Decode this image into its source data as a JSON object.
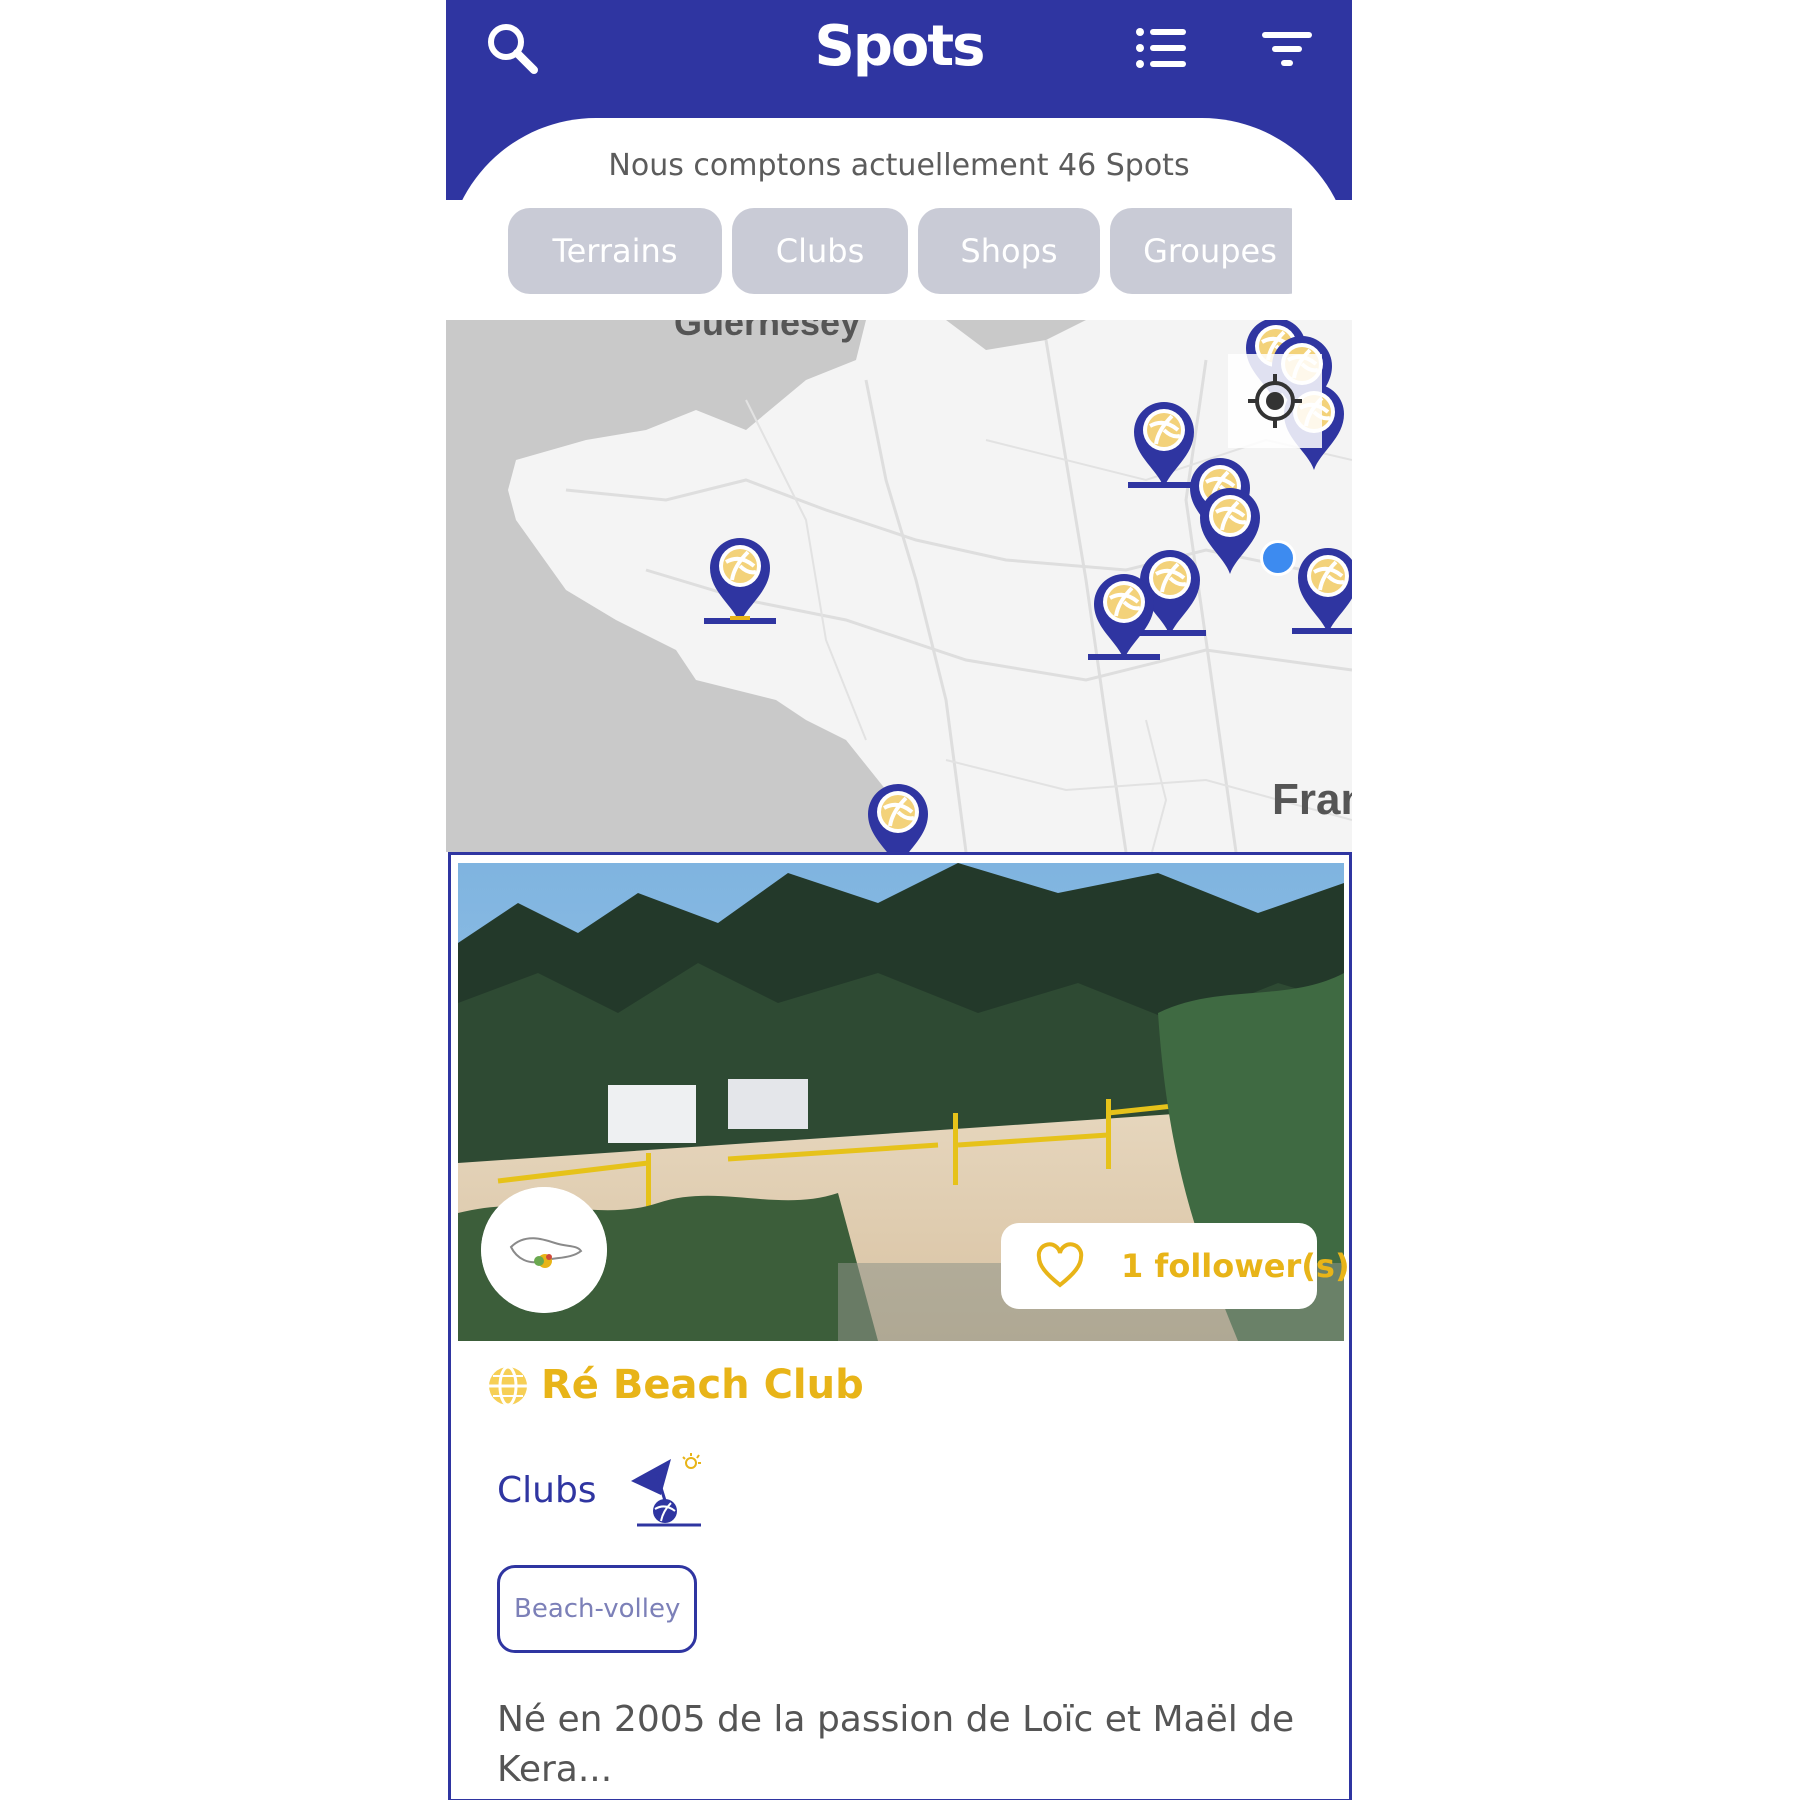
{
  "header": {
    "title": "Spots",
    "left_icon": "search-icon",
    "right_icons": [
      "list-icon",
      "filter-icon"
    ]
  },
  "summary": {
    "text": "Nous comptons actuellement 46 Spots"
  },
  "categories": [
    "Terrains",
    "Clubs",
    "Shops",
    "Groupes"
  ],
  "map": {
    "labels": {
      "guernsey": "Guernesey",
      "france": "Fran"
    },
    "locate_icon": "crosshair-icon",
    "pin_icon": "volleyball-pin-icon"
  },
  "spot_card": {
    "name": "Ré Beach Club",
    "name_icon": "globe-icon",
    "followers": "1 follower(s)",
    "follow_icon": "heart-icon",
    "category": "Clubs",
    "category_icon": "beach-umbrella-volleyball-icon",
    "tag": "Beach-volley",
    "description": "Né en 2005 de la passion  de Loïc et Maël de Kera..."
  },
  "colors": {
    "brand": "#2f35a1",
    "accent": "#e8b418",
    "chip": "#c9cbd6"
  }
}
